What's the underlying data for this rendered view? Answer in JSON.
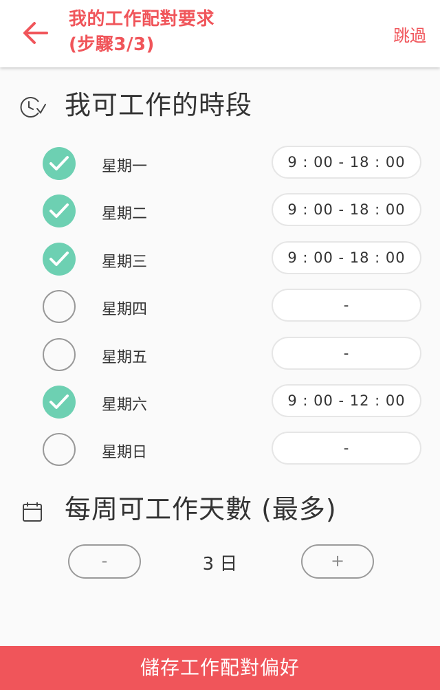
{
  "header": {
    "title_line1": "我的工作配對要求",
    "title_line2": "(步驟3/3)",
    "skip_label": "跳過"
  },
  "availability": {
    "title": "我可工作的時段",
    "days": [
      {
        "label": "星期一",
        "checked": true,
        "time": "9 : 00 - 18 : 00"
      },
      {
        "label": "星期二",
        "checked": true,
        "time": "9 : 00 - 18 : 00"
      },
      {
        "label": "星期三",
        "checked": true,
        "time": "9 : 00 - 18 : 00"
      },
      {
        "label": "星期四",
        "checked": false,
        "time": "-"
      },
      {
        "label": "星期五",
        "checked": false,
        "time": "-"
      },
      {
        "label": "星期六",
        "checked": true,
        "time": "9 : 00 - 12 : 00"
      },
      {
        "label": "星期日",
        "checked": false,
        "time": "-"
      }
    ]
  },
  "max_days": {
    "title": "每周可工作天數 (最多)",
    "minus_label": "-",
    "plus_label": "+",
    "value": "3 日"
  },
  "save_label": "儲存工作配對偏好",
  "colors": {
    "accent": "#f0555a",
    "check_on": "#6dd0b2"
  }
}
